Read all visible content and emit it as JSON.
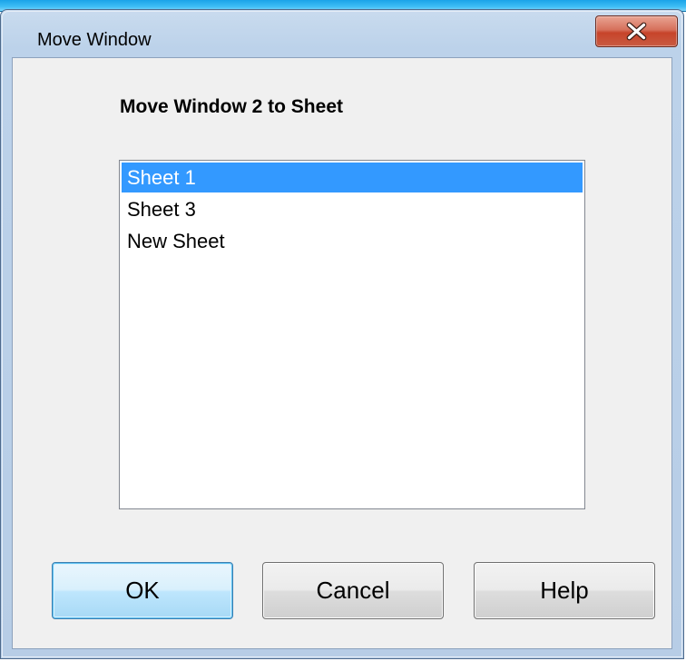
{
  "window": {
    "title": "Move Window"
  },
  "dialog": {
    "prompt": "Move Window 2 to Sheet",
    "list": {
      "items": [
        "Sheet 1",
        "Sheet 3",
        "New Sheet"
      ],
      "selected": "Sheet 1"
    },
    "buttons": {
      "ok": "OK",
      "cancel": "Cancel",
      "help": "Help"
    }
  },
  "colors": {
    "selection": "#3399ff",
    "close_button": "#c7442a",
    "titlebar": "#bcd2ea",
    "background_strip": "#3dbdf5"
  },
  "icons": {
    "close": "close-icon"
  }
}
